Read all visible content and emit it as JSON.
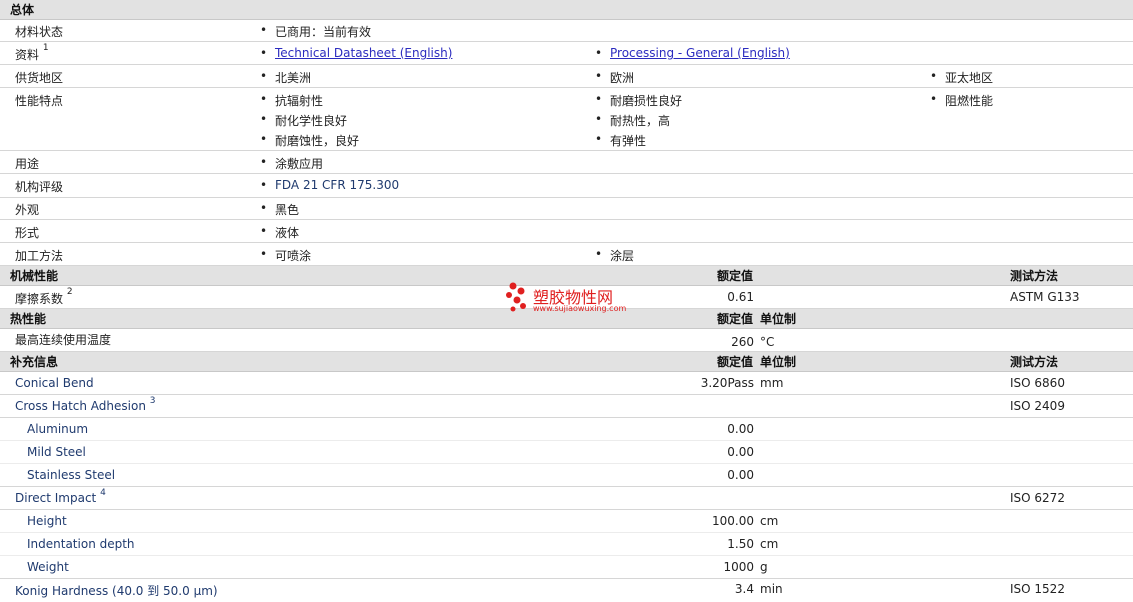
{
  "general": {
    "title": "总体",
    "status_label": "材料状态",
    "status_value": "已商用：当前有效",
    "docs_label": "资料",
    "docs_sup": "1",
    "doc1": "Technical Datasheet (English)",
    "doc2": "Processing - General (English)",
    "region_label": "供货地区",
    "regions": [
      "北美洲",
      "欧洲",
      "亚太地区"
    ],
    "features_label": "性能特点",
    "features": [
      "抗辐射性",
      "耐磨损性良好",
      "阻燃性能",
      "耐化学性良好",
      "耐热性，高",
      "耐磨蚀性，良好",
      "有弹性"
    ],
    "use_label": "用途",
    "use_value": "涂敷应用",
    "agency_label": "机构评级",
    "agency_value": "FDA 21 CFR 175.300",
    "appearance_label": "外观",
    "appearance_value": "黑色",
    "form_label": "形式",
    "form_value": "液体",
    "process_label": "加工方法",
    "processes": [
      "可喷涂",
      "涂层"
    ]
  },
  "mechanical": {
    "title": "机械性能",
    "h_value": "额定值",
    "h_method": "测试方法",
    "friction_label": "摩擦系数",
    "friction_sup": "2",
    "friction_value": "0.61",
    "friction_method": "ASTM G133"
  },
  "thermal": {
    "title": "热性能",
    "h_value": "额定值",
    "h_unit": "单位制",
    "temp_label": "最高连续使用温度",
    "temp_value": "260",
    "temp_unit": "°C"
  },
  "extra": {
    "title": "补充信息",
    "h_value": "额定值",
    "h_unit": "单位制",
    "h_method": "测试方法",
    "conical_label": "Conical Bend",
    "conical_value": "3.20Pass",
    "conical_unit": "mm",
    "conical_method": "ISO 6860",
    "hatch_label": "Cross Hatch Adhesion",
    "hatch_sup": "3",
    "hatch_method": "ISO 2409",
    "aluminum_label": "Aluminum",
    "aluminum_value": "0.00",
    "mild_label": "Mild Steel",
    "mild_value": "0.00",
    "stainless_label": "Stainless Steel",
    "stainless_value": "0.00",
    "impact_label": "Direct Impact",
    "impact_sup": "4",
    "impact_method": "ISO 6272",
    "height_label": "Height",
    "height_value": "100.00",
    "height_unit": "cm",
    "indent_label": "Indentation depth",
    "indent_value": "1.50",
    "indent_unit": "cm",
    "weight_label": "Weight",
    "weight_value": "1000",
    "weight_unit": "g",
    "konig_label": "Konig Hardness (40.0 到  50.0 µm)",
    "konig_value": "3.4",
    "konig_unit": "min",
    "konig_method": "ISO 1522"
  },
  "watermark": {
    "name": "塑胶物性网",
    "url": "www.sujiaowuxing.com"
  }
}
